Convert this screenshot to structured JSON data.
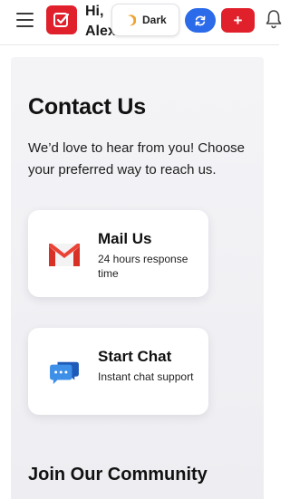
{
  "header": {
    "greeting_line1": "Hi,",
    "greeting_line2": "Alex",
    "theme_label": "Dark",
    "add_label": "+",
    "icons": {
      "menu": "hamburger-menu-icon",
      "logo": "checkbox-app-logo",
      "theme": "crescent-moon-icon",
      "refresh": "refresh-icon",
      "notifications": "bell-icon"
    },
    "colors": {
      "brand_red": "#e0202b",
      "accent_blue": "#2b6be9"
    }
  },
  "contact": {
    "title": "Contact Us",
    "intro": "We’d love to hear from you! Choose your preferred way to reach us.",
    "options": [
      {
        "title": "Mail Us",
        "subtitle": "24 hours response time",
        "icon": "gmail-icon"
      },
      {
        "title": "Start Chat",
        "subtitle": "Instant chat support",
        "icon": "chat-bubbles-icon"
      }
    ]
  },
  "community": {
    "title": "Join Our Community"
  }
}
